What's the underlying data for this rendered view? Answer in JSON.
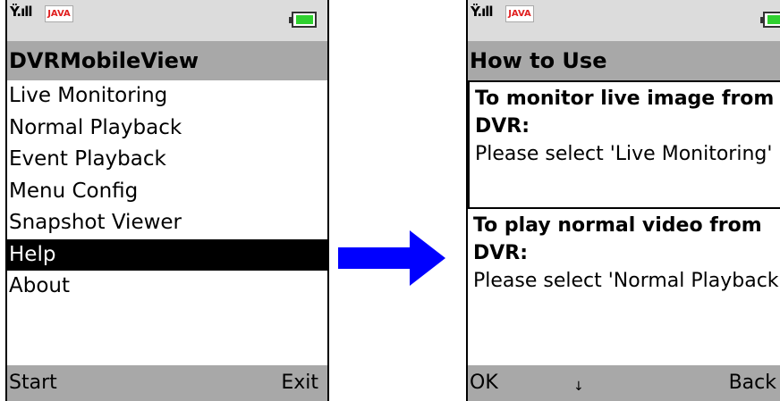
{
  "left_screen": {
    "status": {
      "signal": "Ÿ.ıll",
      "java_badge": "JAVA"
    },
    "title": "DVRMobileView",
    "menu_items": [
      "Live Monitoring",
      "Normal Playback",
      "Event Playback",
      "Menu Config",
      "Snapshot Viewer",
      "Help",
      "About"
    ],
    "selected_item": "Help",
    "softkeys": {
      "left": "Start",
      "right": "Exit"
    }
  },
  "right_screen": {
    "status": {
      "signal": "Ÿ.ıll",
      "java_badge": "JAVA"
    },
    "title": "How to Use",
    "sections": [
      {
        "heading": "To monitor live image from DVR:",
        "body": "Please select 'Live Monitoring'"
      },
      {
        "heading": "To play normal video from DVR:",
        "body": "Please select 'Normal Playback'"
      }
    ],
    "softkeys": {
      "left": "OK",
      "middle": "↓",
      "right": "Back"
    }
  },
  "colors": {
    "arrow": "#0000ff",
    "battery": "#2fd12f",
    "title_bar": "#a8a8a8",
    "status_bar": "#dcdcdc"
  }
}
